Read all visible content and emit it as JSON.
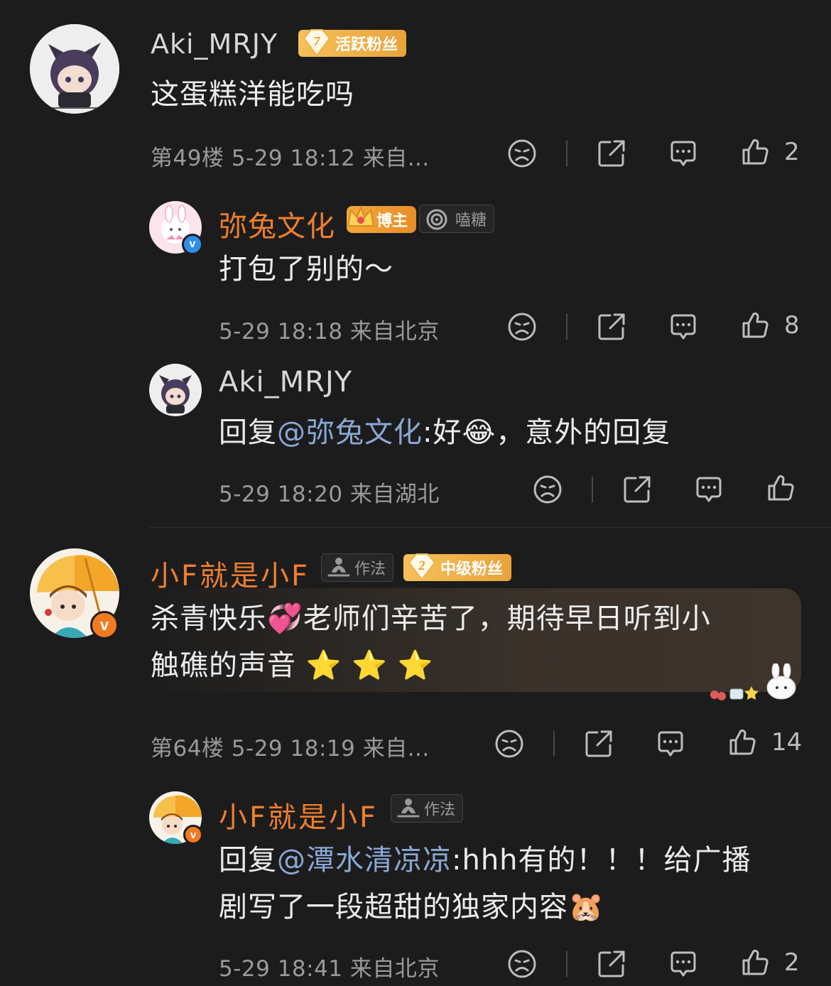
{
  "comments": [
    {
      "user": "Aki_MRJY",
      "fan_badge": {
        "level": "7",
        "label": "活跃粉丝"
      },
      "text": "这蛋糕洋能吃吗",
      "meta": "第49楼 5-29 18:12 来自...",
      "likes": "2",
      "replies": [
        {
          "user": "弥兔文化",
          "role_badge": "博主",
          "extra_badge": "嗑糖",
          "text": "打包了别的～",
          "meta": "5-29 18:18 来自北京",
          "likes": "8"
        },
        {
          "user": "Aki_MRJY",
          "prefix": "回复",
          "mention": "@弥兔文化",
          "text_a": ":好",
          "emoji": "😂",
          "text_b": "，意外的回复",
          "meta": "5-29 18:20 来自湖北",
          "likes": ""
        }
      ]
    },
    {
      "user": "小F就是小F",
      "title_badge": "作法",
      "fan_badge": {
        "level": "2",
        "label": "中级粉丝"
      },
      "text_a": "杀青快乐",
      "emoji_a": "💞",
      "text_b": "老师们辛苦了，期待早日听到小",
      "text_c": "触礁的声音",
      "emoji_stars": [
        "⭐",
        "⭐",
        "⭐"
      ],
      "meta": "第64楼 5-29 18:19 来自...",
      "likes": "14",
      "replies": [
        {
          "user": "小F就是小F",
          "title_badge": "作法",
          "prefix": "回复",
          "mention": "@潭水清凉凉",
          "text_a": ":hhh有的！！！给广播",
          "text_b": "剧写了一段超甜的独家内容",
          "emoji": "🐹",
          "meta": "5-29 18:41 来自北京",
          "likes": "2"
        }
      ]
    }
  ],
  "icons": {
    "dislike": "sad-face-icon",
    "share": "share-icon",
    "comment": "comment-icon",
    "like": "thumbs-up-icon"
  },
  "colors": {
    "background": "#1c1c1c",
    "username_orange": "#ef7f2f",
    "mention_blue": "#8aa8d6",
    "fan_badge": "#f0b24a",
    "verified_blue": "#2f8fe8",
    "verified_orange": "#f27b22"
  }
}
